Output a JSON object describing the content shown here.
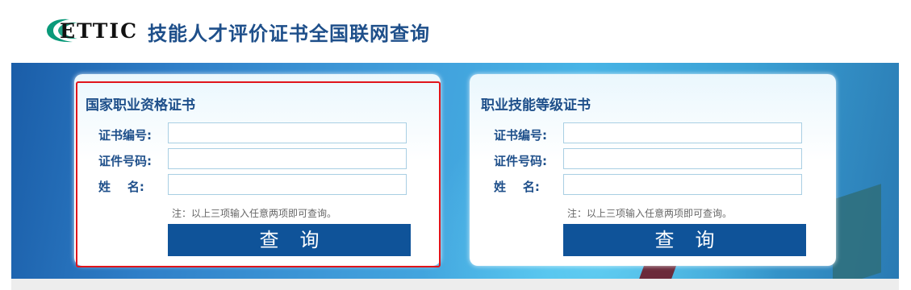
{
  "header": {
    "logo_text": "ETTIC",
    "title": "技能人才评价证书全国联网查询"
  },
  "cards": [
    {
      "title": "国家职业资格证书",
      "fields": [
        {
          "label": "证书编号:",
          "value": ""
        },
        {
          "label": "证件号码:",
          "value": ""
        },
        {
          "label": "姓    名:",
          "value": ""
        }
      ],
      "note": "注：以上三项输入任意两项即可查询。",
      "button": "查询"
    },
    {
      "title": "职业技能等级证书",
      "fields": [
        {
          "label": "证书编号:",
          "value": ""
        },
        {
          "label": "证件号码:",
          "value": ""
        },
        {
          "label": "姓    名:",
          "value": ""
        }
      ],
      "note": "注：以上三项输入任意两项即可查询。",
      "button": "查询"
    }
  ],
  "colors": {
    "title_blue": "#1e4f8a",
    "button_blue": "#0f5399",
    "highlight_red": "#e0141b",
    "logo_green": "#0a9a7a"
  }
}
